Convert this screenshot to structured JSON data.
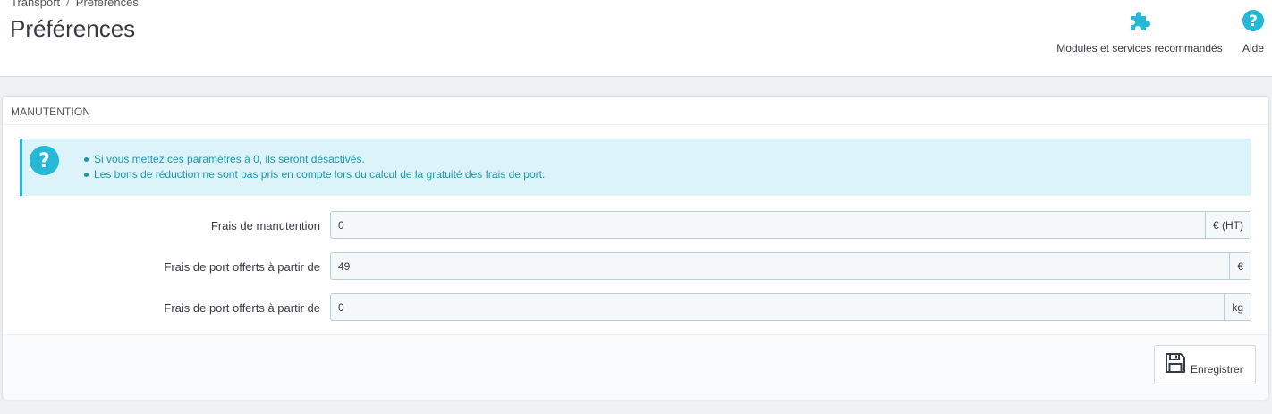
{
  "breadcrumb": {
    "parent": "Transport",
    "separator": "/",
    "current": "Préférences"
  },
  "page_title": "Préférences",
  "toolbar": {
    "modules_label": "Modules et services recommandés",
    "help_label": "Aide"
  },
  "panel": {
    "heading": "MANUTENTION",
    "alert": {
      "items": [
        "Si vous mettez ces paramètres à 0, ils seront désactivés.",
        "Les bons de réduction ne sont pas pris en compte lors du calcul de la gratuité des frais de port."
      ]
    },
    "fields": [
      {
        "label": "Frais de manutention",
        "value": "0",
        "addon": "€ (HT)"
      },
      {
        "label": "Frais de port offerts à partir de",
        "value": "49",
        "addon": "€"
      },
      {
        "label": "Frais de port offerts à partir de",
        "value": "0",
        "addon": "kg"
      }
    ],
    "save_label": "Enregistrer"
  },
  "colors": {
    "accent": "#25b9d7",
    "alert_bg": "#dcf4f9",
    "alert_text": "#1e94ab",
    "page_bg": "#eff1f2"
  },
  "icons": {
    "modules": "puzzle-icon",
    "help": "question-circle-icon",
    "alert": "question-circle-icon",
    "save": "floppy-disk-icon"
  }
}
